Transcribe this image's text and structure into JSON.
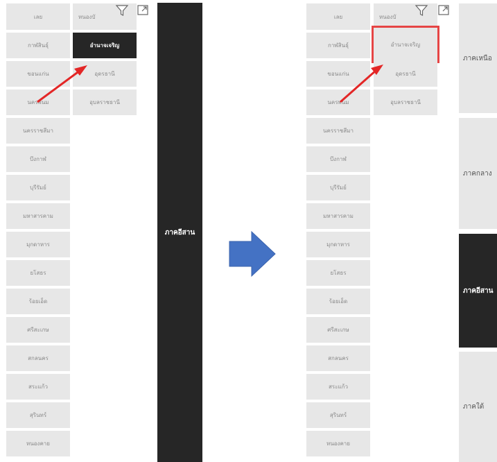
{
  "left_panel": {
    "col1": [
      "เลย",
      "กาฬสินธุ์",
      "ขอนแก่น",
      "นครพนม",
      "นครราชสีมา",
      "บึงกาฬ",
      "บุรีรัมย์",
      "มหาสารคาม",
      "มุกดาหาร",
      "ยโสธร",
      "ร้อยเอ็ด",
      "ศรีสะเกษ",
      "สกลนคร",
      "สระแก้ว",
      "สุรินทร์",
      "หนองคาย"
    ],
    "col2": [
      "หนองบั",
      "อำนาจเจริญ",
      "อุดรธานี",
      "อุบลราชธานี"
    ],
    "selected": "อำนาจเจริญ",
    "region_bar_label": "ภาคอีสาน"
  },
  "right_panel": {
    "col1": [
      "เลย",
      "กาฬสินธุ์",
      "ขอนแก่น",
      "นครพนม",
      "นครราชสีมา",
      "บึงกาฬ",
      "บุรีรัมย์",
      "มหาสารคาม",
      "มุกดาหาร",
      "ยโสธร",
      "ร้อยเอ็ด",
      "ศรีสะเกษ",
      "สกลนคร",
      "สระแก้ว",
      "สุรินทร์",
      "หนองคาย"
    ],
    "col2": [
      "หนองบั",
      "อำนาจเจริญ",
      "อุดรธานี",
      "อุบลราชธานี"
    ],
    "highlighted": "อำนาจเจริญ",
    "regions": [
      "ภาคเหนือ",
      "ภาคกลาง",
      "ภาคอีสาน",
      "ภาคใต้"
    ],
    "active_region": "ภาคอีสาน"
  },
  "icons": {
    "filter": "filter-icon",
    "focus": "focus-mode-icon"
  },
  "colors": {
    "tile_bg": "#e7e7e7",
    "tile_text": "#8a8a8a",
    "active_bg": "#262626",
    "arrow_red": "#e32626",
    "highlight_border": "#e64545",
    "flow_arrow": "#4472c4"
  }
}
